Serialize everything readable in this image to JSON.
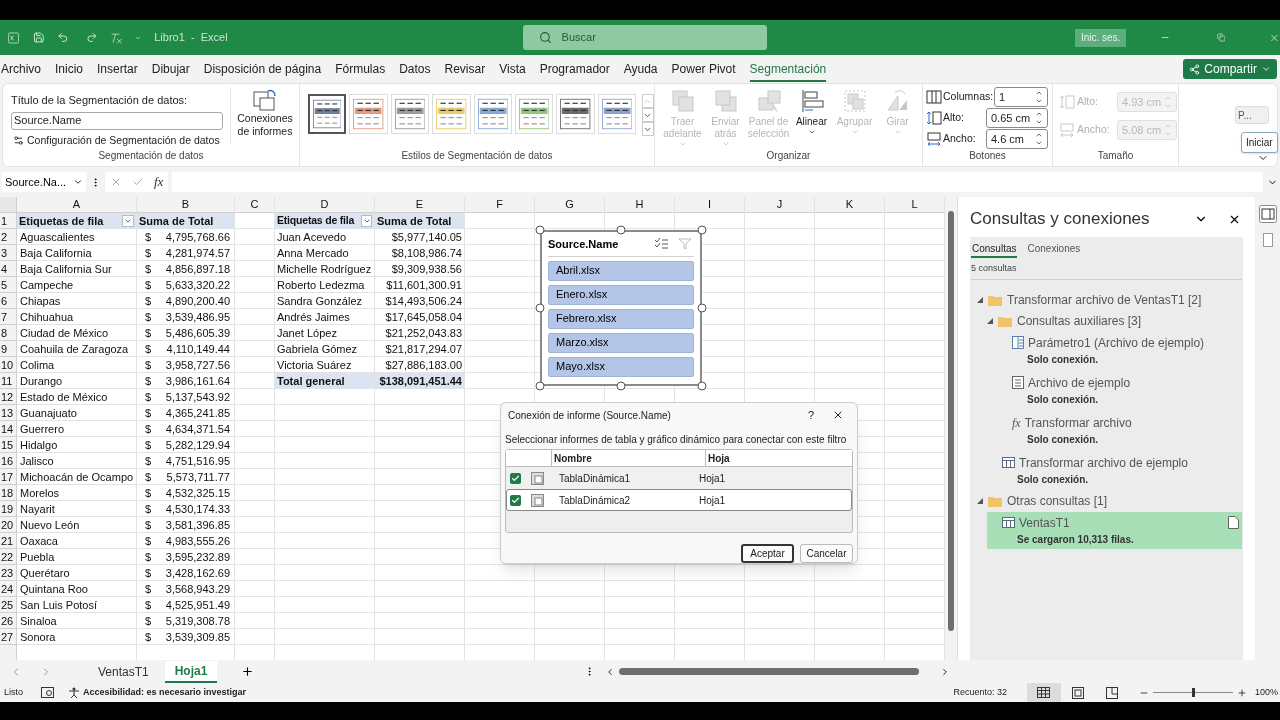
{
  "title_bar": {
    "document_title": "Libro1  -  Excel",
    "search_placeholder": "Buscar",
    "sign_in": "Inic. ses."
  },
  "menu_tabs": [
    {
      "label": "Archivo",
      "selected": false
    },
    {
      "label": "Inicio",
      "selected": false
    },
    {
      "label": "Insertar",
      "selected": false
    },
    {
      "label": "Dibujar",
      "selected": false
    },
    {
      "label": "Disposición de página",
      "selected": false
    },
    {
      "label": "Fórmulas",
      "selected": false
    },
    {
      "label": "Datos",
      "selected": false
    },
    {
      "label": "Revisar",
      "selected": false
    },
    {
      "label": "Vista",
      "selected": false
    },
    {
      "label": "Programador",
      "selected": false
    },
    {
      "label": "Ayuda",
      "selected": false
    },
    {
      "label": "Power Pivot",
      "selected": false
    },
    {
      "label": "Segmentación",
      "selected": true
    }
  ],
  "share_button": "Compartir",
  "ribbon": {
    "slicer_group": {
      "caption_label": "Título de la Segmentación de datos:",
      "caption_value": "Source.Name",
      "settings_button": "Configuración de Segmentación de datos",
      "connections_button": "Conexiones de informes",
      "label": "Segmentación de datos"
    },
    "styles_group": {
      "label": "Estilos de Segmentación de datos",
      "styles": [
        {
          "color": "#6f7f9f",
          "selected": true
        },
        {
          "color": "#e39a80",
          "selected": false
        },
        {
          "color": "#9a9a9a",
          "selected": false
        },
        {
          "color": "#e6cc66",
          "selected": false
        },
        {
          "color": "#88a9d6",
          "selected": false
        },
        {
          "color": "#93c47d",
          "selected": false
        },
        {
          "color": "#6b6b6b",
          "selected": false
        },
        {
          "color": "#8aa2cc",
          "selected": false
        }
      ]
    },
    "arrange_group": {
      "label": "Organizar",
      "buttons": [
        {
          "kind": "front",
          "label": "Traer adelante",
          "disabled": true,
          "menu": true
        },
        {
          "kind": "back",
          "label": "Enviar atrás",
          "disabled": true,
          "menu": true
        },
        {
          "kind": "pane",
          "label": "Panel de selección",
          "disabled": true,
          "menu": false
        },
        {
          "kind": "align",
          "label": "Alinear",
          "disabled": false,
          "menu": true
        },
        {
          "kind": "group",
          "label": "Agrupar",
          "disabled": true,
          "menu": true
        },
        {
          "kind": "rotate",
          "label": "Girar",
          "disabled": true,
          "menu": true
        }
      ]
    },
    "buttons_group": {
      "label": "Botones",
      "fields": [
        {
          "kind": "columns",
          "label": "Columnas:",
          "value": "1",
          "disabled": false
        },
        {
          "kind": "height",
          "label": "Alto:",
          "value": "0.65 cm",
          "disabled": false
        },
        {
          "kind": "width",
          "label": "Ancho:",
          "value": "4.6 cm",
          "disabled": false
        }
      ]
    },
    "size_group": {
      "label": "Tamaño",
      "fields": [
        {
          "kind": "height",
          "label": "Alto:",
          "value": "4.93 cm",
          "disabled": true
        },
        {
          "kind": "width",
          "label": "Ancho:",
          "value": "5.08 cm",
          "disabled": true
        }
      ]
    },
    "extra_button": "P...",
    "tooltip": "Iniciar"
  },
  "formula_bar": {
    "name_box": "Source.Na...",
    "function_symbol": "fx"
  },
  "sheet": {
    "columns": [
      "A",
      "B",
      "C",
      "D",
      "E",
      "F",
      "G",
      "H",
      "I",
      "J",
      "K",
      "L"
    ],
    "row_numbers": [
      "1",
      "2",
      "3",
      "4",
      "5",
      "6",
      "7",
      "8",
      "9",
      "10",
      "11",
      "12",
      "13",
      "14",
      "15",
      "16",
      "17",
      "18",
      "19",
      "20",
      "21",
      "22",
      "23",
      "24",
      "25",
      "26",
      "27"
    ],
    "pivot1": {
      "headers": [
        "Etiquetas de fila",
        "Suma de Total"
      ],
      "rows": [
        {
          "label": "Aguascalientes",
          "currency": "$",
          "value": "4,795,768.66"
        },
        {
          "label": "Baja California",
          "currency": "$",
          "value": "4,281,974.57"
        },
        {
          "label": "Baja California Sur",
          "currency": "$",
          "value": "4,856,897.18"
        },
        {
          "label": "Campeche",
          "currency": "$",
          "value": "5,633,320.22"
        },
        {
          "label": "Chiapas",
          "currency": "$",
          "value": "4,890,200.40"
        },
        {
          "label": "Chihuahua",
          "currency": "$",
          "value": "3,539,486.95"
        },
        {
          "label": "Ciudad de México",
          "currency": "$",
          "value": "5,486,605.39"
        },
        {
          "label": "Coahuila de Zaragoza",
          "currency": "$",
          "value": "4,110,149.44"
        },
        {
          "label": "Colima",
          "currency": "$",
          "value": "3,958,727.56"
        },
        {
          "label": "Durango",
          "currency": "$",
          "value": "3,986,161.64"
        },
        {
          "label": "Estado de México",
          "currency": "$",
          "value": "5,137,543.92"
        },
        {
          "label": "Guanajuato",
          "currency": "$",
          "value": "4,365,241.85"
        },
        {
          "label": "Guerrero",
          "currency": "$",
          "value": "4,634,371.54"
        },
        {
          "label": "Hidalgo",
          "currency": "$",
          "value": "5,282,129.94"
        },
        {
          "label": "Jalisco",
          "currency": "$",
          "value": "4,751,516.95"
        },
        {
          "label": "Michoacán de Ocampo",
          "currency": "$",
          "value": "5,573,711.77"
        },
        {
          "label": "Morelos",
          "currency": "$",
          "value": "4,532,325.15"
        },
        {
          "label": "Nayarit",
          "currency": "$",
          "value": "4,530,174.33"
        },
        {
          "label": "Nuevo León",
          "currency": "$",
          "value": "3,581,396.85"
        },
        {
          "label": "Oaxaca",
          "currency": "$",
          "value": "4,983,555.26"
        },
        {
          "label": "Puebla",
          "currency": "$",
          "value": "3,595,232.89"
        },
        {
          "label": "Querétaro",
          "currency": "$",
          "value": "3,428,162.69"
        },
        {
          "label": "Quintana Roo",
          "currency": "$",
          "value": "3,568,943.29"
        },
        {
          "label": "San Luis Potosí",
          "currency": "$",
          "value": "4,525,951.49"
        },
        {
          "label": "Sinaloa",
          "currency": "$",
          "value": "5,319,308.78"
        },
        {
          "label": "Sonora",
          "currency": "$",
          "value": "3,539,309.85"
        }
      ]
    },
    "pivot2": {
      "headers": [
        "Etiquetas de fila",
        "Suma de Total"
      ],
      "rows": [
        {
          "label": "Juan Acevedo",
          "value": "$5,977,140.05"
        },
        {
          "label": "Anna Mercado",
          "value": "$8,108,986.74"
        },
        {
          "label": "Michelle Rodríguez",
          "value": "$9,309,938.56"
        },
        {
          "label": "Roberto Ledezma",
          "value": "$11,601,300.91"
        },
        {
          "label": "Sandra González",
          "value": "$14,493,506.24"
        },
        {
          "label": "Andrés Jaimes",
          "value": "$17,645,058.04"
        },
        {
          "label": "Janet López",
          "value": "$21,252,043.83"
        },
        {
          "label": "Gabriela Gómez",
          "value": "$21,817,294.07"
        },
        {
          "label": "Victoria Suárez",
          "value": "$27,886,183.00"
        }
      ],
      "total": {
        "label": "Total general",
        "value": "$138,091,451.44"
      }
    }
  },
  "slicer": {
    "title": "Source.Name",
    "items": [
      {
        "label": "Abril.xlsx",
        "selected": true
      },
      {
        "label": "Enero.xlsx",
        "selected": true
      },
      {
        "label": "Febrero.xlsx",
        "selected": true
      },
      {
        "label": "Marzo.xlsx",
        "selected": true
      },
      {
        "label": "Mayo.xlsx",
        "selected": true
      }
    ]
  },
  "dialog": {
    "title": "Conexión de informe (Source.Name)",
    "help": "?",
    "description": "Seleccionar informes de tabla y gráfico dinámico para conectar con este filtro",
    "columns": [
      "Nombre",
      "Hoja"
    ],
    "rows": [
      {
        "name": "TablaDinámica1",
        "sheet": "Hoja1",
        "checked": true,
        "selected": false
      },
      {
        "name": "TablaDinámica2",
        "sheet": "Hoja1",
        "checked": true,
        "selected": true
      }
    ],
    "buttons": [
      {
        "label": "Aceptar",
        "default": true
      },
      {
        "label": "Cancelar",
        "default": false
      }
    ]
  },
  "queries_pane": {
    "title": "Consultas y conexiones",
    "tabs": [
      {
        "label": "Consultas",
        "selected": true
      },
      {
        "label": "Conexiones",
        "selected": false
      }
    ],
    "count": "5 consultas",
    "tree": [
      {
        "kind": "group",
        "label": "Transformar archivo de VentasT1 [2]",
        "expanded": true,
        "children": [
          {
            "kind": "group",
            "label": "Consultas auxiliares [3]",
            "expanded": true,
            "children": [
              {
                "kind": "parameter",
                "label": "Parámetro1 (Archivo de ejemplo)",
                "status": "Solo conexión.",
                "selected": false
              },
              {
                "kind": "file",
                "label": "Archivo de ejemplo",
                "status": "Solo conexión.",
                "selected": false
              },
              {
                "kind": "function",
                "icon_glyph": "fx",
                "label": "Transformar archivo",
                "status": "Solo conexión.",
                "selected": false
              }
            ]
          },
          {
            "kind": "table",
            "label": "Transformar archivo de ejemplo",
            "status": "Solo conexión.",
            "selected": false
          }
        ]
      },
      {
        "kind": "group",
        "label": "Otras consultas [1]",
        "expanded": true,
        "children": [
          {
            "kind": "table",
            "label": "VentasT1",
            "status": "Se cargaron 10,313 filas.",
            "selected": true
          }
        ]
      }
    ]
  },
  "sheet_tabs": [
    {
      "label": "VentasT1",
      "selected": false
    },
    {
      "label": "Hoja1",
      "selected": true
    }
  ],
  "status_bar": {
    "ready": "Listo",
    "accessibility": "Accesibilidad: es necesario investigar",
    "count": "Recuento: 32",
    "views": [
      {
        "kind": "normal",
        "selected": true
      },
      {
        "kind": "layout",
        "selected": false
      },
      {
        "kind": "pagebreak",
        "selected": false
      }
    ],
    "zoom": {
      "level": 0.5,
      "reading": "100%"
    }
  }
}
